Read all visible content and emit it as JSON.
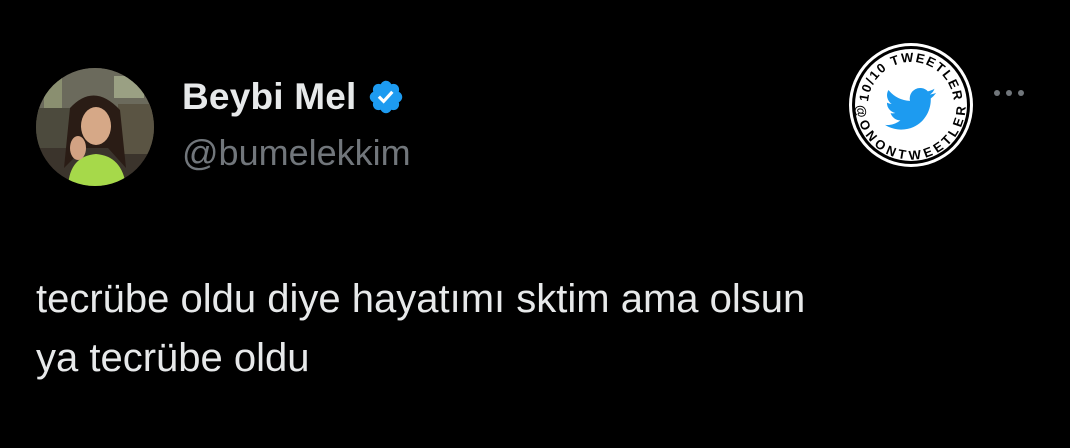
{
  "author": {
    "display_name": "Beybi Mel",
    "handle": "@bumelekkim",
    "verified": true,
    "verified_color": "#1d9bf0"
  },
  "tweet": {
    "lines": [
      "tecrübe oldu diye hayatımı sktim ama olsun",
      "ya tecrübe oldu"
    ]
  },
  "badge": {
    "top_text": "10/10 TWEETLER",
    "bottom_text": "@ONONTWEETLER",
    "icon": "twitter-bird-icon",
    "accent": "#1d9bf0"
  },
  "actions": {
    "more_icon": "more-icon"
  },
  "colors": {
    "background": "#000000",
    "primary_text": "#e7e9ea",
    "secondary_text": "#71767b"
  }
}
